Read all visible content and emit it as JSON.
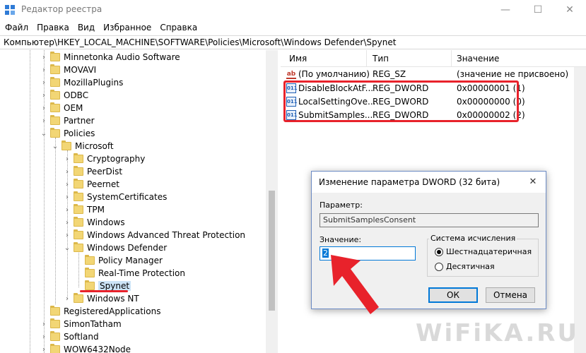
{
  "window": {
    "title": "Редактор реестра",
    "minimize": "—",
    "maximize": "☐",
    "close": "✕"
  },
  "menu": [
    "Файл",
    "Правка",
    "Вид",
    "Избранное",
    "Справка"
  ],
  "address": "Компьютер\\HKEY_LOCAL_MACHINE\\SOFTWARE\\Policies\\Microsoft\\Windows Defender\\Spynet",
  "tree": {
    "items": [
      {
        "label": "Minnetonka Audio Software",
        "expanded": false,
        "has_children": true
      },
      {
        "label": "MOVAVI",
        "expanded": false,
        "has_children": true
      },
      {
        "label": "MozillaPlugins",
        "expanded": false,
        "has_children": true
      },
      {
        "label": "ODBC",
        "expanded": false,
        "has_children": true
      },
      {
        "label": "OEM",
        "expanded": false,
        "has_children": true
      },
      {
        "label": "Partner",
        "expanded": false,
        "has_children": true
      },
      {
        "label": "Policies",
        "expanded": true,
        "has_children": true
      },
      {
        "label": "Microsoft",
        "expanded": true,
        "has_children": true
      },
      {
        "label": "Cryptography",
        "expanded": false,
        "has_children": true
      },
      {
        "label": "PeerDist",
        "expanded": false,
        "has_children": true
      },
      {
        "label": "Peernet",
        "expanded": false,
        "has_children": true
      },
      {
        "label": "SystemCertificates",
        "expanded": false,
        "has_children": true
      },
      {
        "label": "TPM",
        "expanded": false,
        "has_children": true
      },
      {
        "label": "Windows",
        "expanded": false,
        "has_children": true
      },
      {
        "label": "Windows Advanced Threat Protection",
        "expanded": false,
        "has_children": true
      },
      {
        "label": "Windows Defender",
        "expanded": true,
        "has_children": true
      },
      {
        "label": "Policy Manager",
        "expanded": false,
        "has_children": false
      },
      {
        "label": "Real-Time Protection",
        "expanded": false,
        "has_children": false
      },
      {
        "label": "Spynet",
        "expanded": false,
        "has_children": false,
        "selected": true
      },
      {
        "label": "Windows NT",
        "expanded": false,
        "has_children": true
      },
      {
        "label": "RegisteredApplications",
        "expanded": false,
        "has_children": false
      },
      {
        "label": "SimonTatham",
        "expanded": false,
        "has_children": true
      },
      {
        "label": "Softland",
        "expanded": false,
        "has_children": true
      },
      {
        "label": "WOW6432Node",
        "expanded": false,
        "has_children": true
      }
    ]
  },
  "list": {
    "columns": [
      "Имя",
      "Тип",
      "Значение"
    ],
    "rows": [
      {
        "icon": "ab",
        "name": "(По умолчанию)",
        "type": "REG_SZ",
        "value": "(значение не присвоено)"
      },
      {
        "icon": "dw",
        "name": "DisableBlockAtF...",
        "type": "REG_DWORD",
        "value": "0x00000001 (1)"
      },
      {
        "icon": "dw",
        "name": "LocalSettingOve...",
        "type": "REG_DWORD",
        "value": "0x00000000 (0)"
      },
      {
        "icon": "dw",
        "name": "SubmitSamples...",
        "type": "REG_DWORD",
        "value": "0x00000002 (2)"
      }
    ]
  },
  "dialog": {
    "title": "Изменение параметра DWORD (32 бита)",
    "close": "✕",
    "param_label": "Параметр:",
    "param_value": "SubmitSamplesConsent",
    "value_label": "Значение:",
    "value": "2",
    "base_title": "Система исчисления",
    "radio_hex": "Шестнадцатеричная",
    "radio_dec": "Десятичная",
    "ok": "ОК",
    "cancel": "Отмена"
  },
  "watermark": "WiFiKA.RU",
  "colors": {
    "highlight": "#e8222b",
    "accent": "#0078d7",
    "folder": "#f2d675"
  }
}
